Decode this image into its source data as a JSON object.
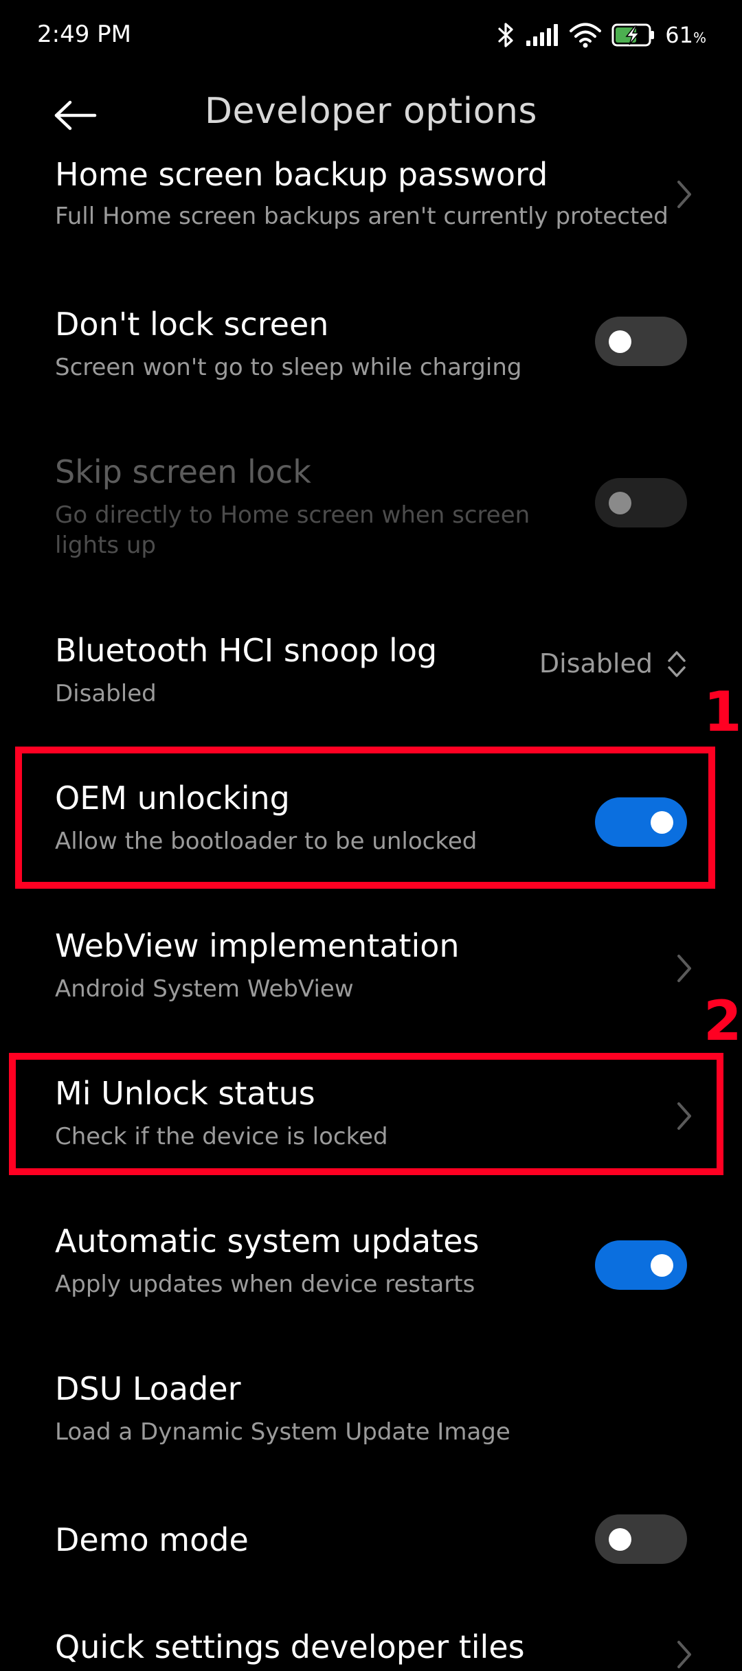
{
  "status_bar": {
    "time": "2:49 PM",
    "battery_percent": "61",
    "battery_unit": "%",
    "icons": [
      "bluetooth-icon",
      "signal-icon",
      "wifi-icon",
      "battery-charging-icon"
    ]
  },
  "header": {
    "back_icon": "arrow-left-icon",
    "title": "Developer options"
  },
  "settings": [
    {
      "title": "Home screen backup password",
      "subtitle": "Full Home screen backups aren't currently protected",
      "control": "chevron"
    },
    {
      "title": "Don't lock screen",
      "subtitle": "Screen won't go to sleep while charging",
      "control": "toggle",
      "state": "off"
    },
    {
      "title": "Skip screen lock",
      "subtitle": "Go directly to Home screen when screen lights up",
      "control": "toggle",
      "state": "off",
      "enabled": false
    },
    {
      "title": "Bluetooth HCI snoop log",
      "subtitle": "Disabled",
      "control": "dropdown",
      "value": "Disabled"
    },
    {
      "title": "OEM unlocking",
      "subtitle": "Allow the bootloader to be unlocked",
      "control": "toggle",
      "state": "on"
    },
    {
      "title": "WebView implementation",
      "subtitle": "Android System WebView",
      "control": "chevron"
    },
    {
      "title": "Mi Unlock status",
      "subtitle": "Check if the device is locked",
      "control": "chevron"
    },
    {
      "title": "Automatic system updates",
      "subtitle": "Apply updates when device restarts",
      "control": "toggle",
      "state": "on"
    },
    {
      "title": "DSU Loader",
      "subtitle": "Load a Dynamic System Update Image",
      "control": "none"
    },
    {
      "title": "Demo mode",
      "subtitle": "",
      "control": "toggle",
      "state": "off"
    },
    {
      "title": "Quick settings developer tiles",
      "subtitle": "",
      "control": "chevron"
    }
  ],
  "annotations": {
    "marker_1": "1",
    "marker_2": "2",
    "highlight_color": "#ff0022"
  },
  "colors": {
    "background": "#000000",
    "toggle_on": "#0b6fdf",
    "toggle_off": "#3a3a3a",
    "subtitle": "#9b9b9b"
  }
}
